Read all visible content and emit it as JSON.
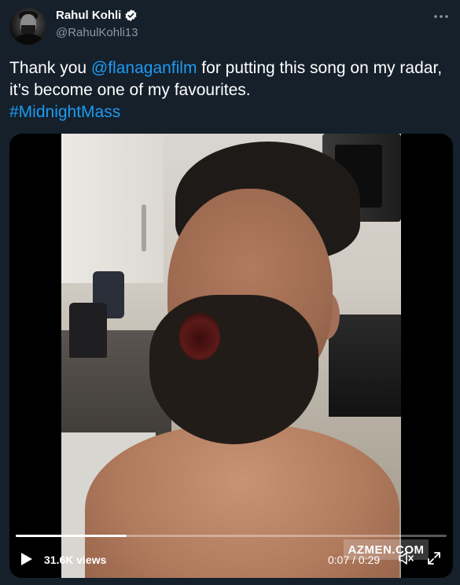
{
  "author": {
    "display_name": "Rahul Kohli",
    "handle": "@RahulKohli13",
    "verified": true,
    "avatar_icon": "profile-photo"
  },
  "menu": {
    "icon": "more-horizontal-icon"
  },
  "tweet": {
    "text_before": "Thank you ",
    "mention": "@flanaganfilm",
    "text_after": " for putting this song on my radar, it’s become one of my favourites.",
    "hashtag": "#MidnightMass"
  },
  "video": {
    "views": "31.6K views",
    "time": "0:07 / 0:29",
    "progress_fraction": 0.258,
    "watermark": "AZMEN.COM",
    "play_icon": "play-icon",
    "volume_icon": "volume-muted-icon",
    "fullscreen_icon": "fullscreen-icon"
  },
  "colors": {
    "background": "#15202b",
    "link": "#1d9bf0",
    "secondary_text": "#8899a6",
    "verified_badge": "#ffffff"
  }
}
